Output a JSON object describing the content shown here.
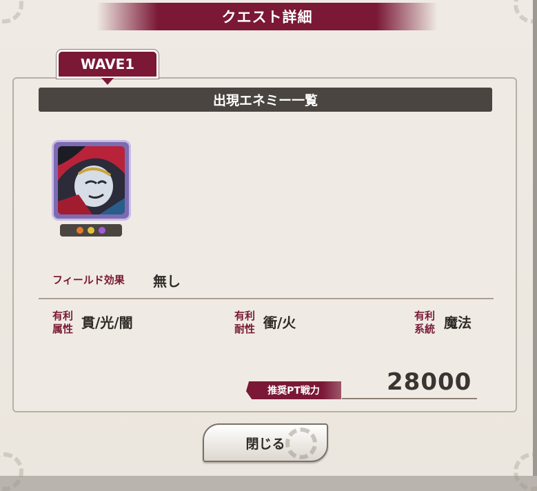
{
  "dialog": {
    "title": "クエスト詳細"
  },
  "wave": {
    "label": "WAVE1"
  },
  "enemy_list": {
    "header": "出現エネミー一覧",
    "enemies": [
      {
        "name_icon": "jester-enemy-portrait",
        "element_dots": [
          "#e07a2e",
          "#e0c040",
          "#a45ad8"
        ]
      }
    ]
  },
  "field": {
    "label": "フィールド効果",
    "value": "無し"
  },
  "advantages": {
    "attribute": {
      "label_line1": "有利",
      "label_line2": "属性",
      "value": "貫/光/闇"
    },
    "resistance": {
      "label_line1": "有利",
      "label_line2": "耐性",
      "value": "衝/火"
    },
    "system": {
      "label_line1": "有利",
      "label_line2": "系統",
      "value": "魔法"
    }
  },
  "recommended_power": {
    "label": "推奨PT戦力",
    "value": "28000"
  },
  "buttons": {
    "close_label": "閉じる"
  },
  "colors": {
    "accent": "#7a1836",
    "header_dark": "#4a4540",
    "panel_bg": "#efebe4"
  }
}
